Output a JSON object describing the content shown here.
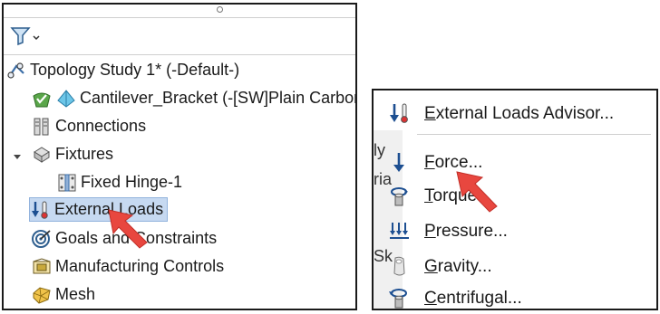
{
  "tree": {
    "filter_icon": "funnel-icon",
    "items": [
      {
        "name": "study-icon",
        "label": "Topology Study 1* (-Default-)"
      },
      {
        "name": "part-icon",
        "label": "Cantilever_Bracket (-[SW]Plain Carbon Steel-)"
      },
      {
        "name": "connections-icon",
        "label": "Connections"
      },
      {
        "name": "fixtures-icon",
        "label": "Fixtures"
      },
      {
        "name": "hinge-icon",
        "label": "Fixed Hinge-1"
      },
      {
        "name": "external-loads-icon",
        "label": "External Loads"
      },
      {
        "name": "goals-icon",
        "label": "Goals and Constraints"
      },
      {
        "name": "manufacturing-icon",
        "label": "Manufacturing Controls"
      },
      {
        "name": "mesh-icon",
        "label": "Mesh"
      }
    ]
  },
  "menu": {
    "background_fragments": [
      "ly",
      "ria",
      "Sk"
    ],
    "items": [
      {
        "name": "advisor-icon",
        "label_prefix": "",
        "label_ul": "E",
        "label_rest": "xternal Loads Advisor..."
      },
      {
        "name": "force-icon",
        "label_prefix": "",
        "label_ul": "F",
        "label_rest": "orce..."
      },
      {
        "name": "torque-icon",
        "label_prefix": "",
        "label_ul": "T",
        "label_rest": "orque..."
      },
      {
        "name": "pressure-icon",
        "label_prefix": "",
        "label_ul": "P",
        "label_rest": "ressure..."
      },
      {
        "name": "gravity-icon",
        "label_prefix": "",
        "label_ul": "G",
        "label_rest": "ravity..."
      },
      {
        "name": "centrifugal-icon",
        "label_prefix": "",
        "label_ul": "C",
        "label_rest": "entrifugal..."
      }
    ]
  },
  "colors": {
    "selection": "#c6d9f1",
    "arrow": "#e8473f",
    "load_blue": "#1d4f91"
  }
}
